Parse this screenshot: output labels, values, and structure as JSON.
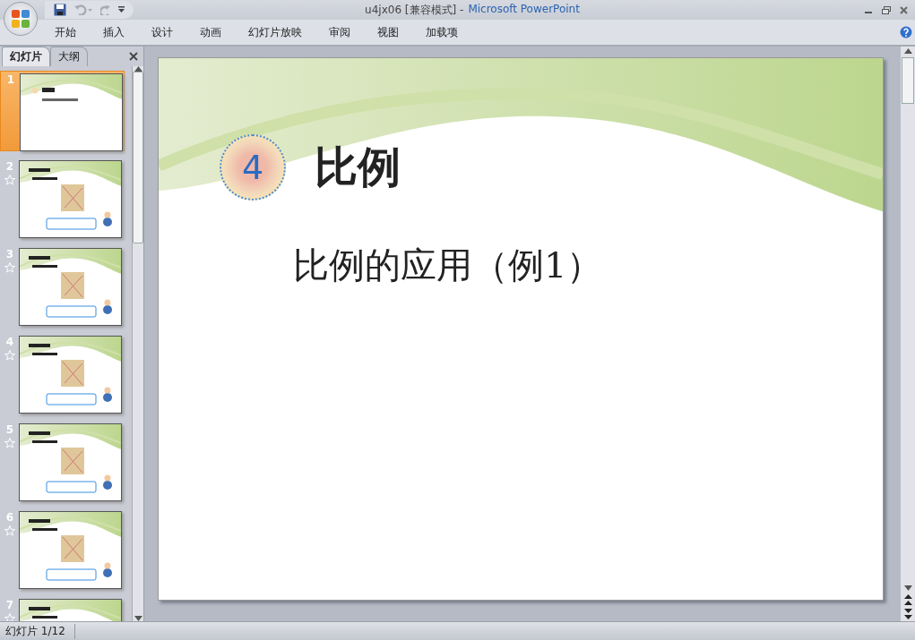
{
  "window": {
    "document": "u4jx06 [兼容模式] -",
    "app_name": "Microsoft PowerPoint"
  },
  "ribbon_tabs": [
    {
      "label": "开始",
      "selected": false
    },
    {
      "label": "插入",
      "selected": false
    },
    {
      "label": "设计",
      "selected": false
    },
    {
      "label": "动画",
      "selected": false
    },
    {
      "label": "幻灯片放映",
      "selected": false
    },
    {
      "label": "审阅",
      "selected": false
    },
    {
      "label": "视图",
      "selected": false
    },
    {
      "label": "加载项",
      "selected": false
    }
  ],
  "panel_tabs": [
    {
      "label": "幻灯片",
      "selected": true
    },
    {
      "label": "大纲",
      "selected": false
    }
  ],
  "slides": [
    {
      "number": "1",
      "selected": true,
      "animated": false,
      "kind": "title"
    },
    {
      "number": "2",
      "selected": false,
      "animated": true,
      "kind": "content"
    },
    {
      "number": "3",
      "selected": false,
      "animated": true,
      "kind": "content"
    },
    {
      "number": "4",
      "selected": false,
      "animated": true,
      "kind": "content"
    },
    {
      "number": "5",
      "selected": false,
      "animated": true,
      "kind": "content"
    },
    {
      "number": "6",
      "selected": false,
      "animated": true,
      "kind": "content"
    },
    {
      "number": "7",
      "selected": false,
      "animated": true,
      "kind": "content"
    }
  ],
  "slide": {
    "badge": "4",
    "title": "比例",
    "subtitle": "比例的应用（例1）"
  },
  "status_bar": {
    "slide_indicator": "幻灯片 1/12"
  }
}
